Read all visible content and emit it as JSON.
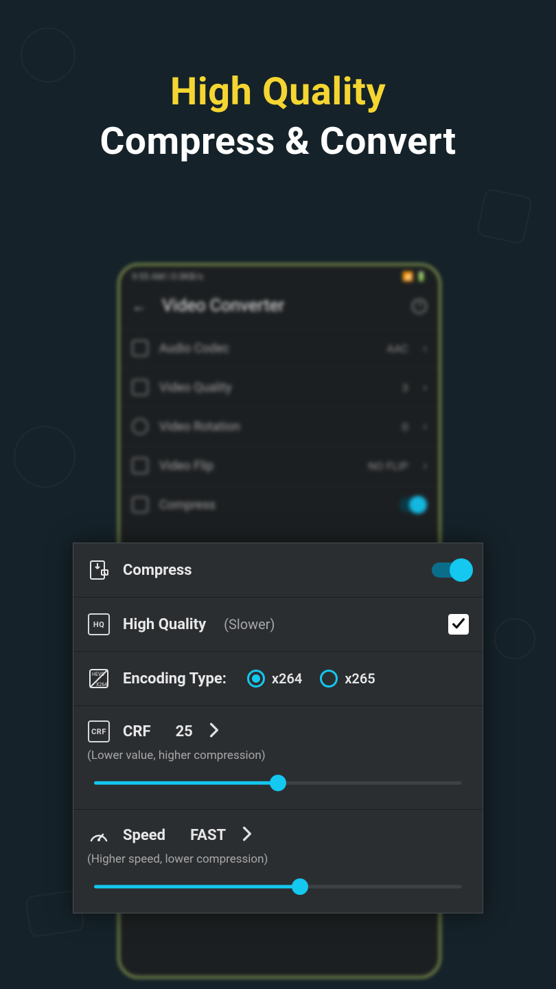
{
  "hero": {
    "line1": "High Quality",
    "line2": "Compress & Convert"
  },
  "phone": {
    "status_left": "9:55 AM | 0.0KB/s",
    "status_right": "📶 🔋",
    "title": "Video Converter",
    "rows": [
      {
        "label": "Audio Codec",
        "value": "AAC"
      },
      {
        "label": "Video Quality",
        "value": "3"
      },
      {
        "label": "Video Rotation",
        "value": "0"
      },
      {
        "label": "Video Flip",
        "value": "NO FLIP"
      }
    ],
    "compress_label": "Compress"
  },
  "card": {
    "compress": {
      "label": "Compress",
      "on": true
    },
    "high_quality": {
      "label": "High Quality",
      "hint": "(Slower)",
      "checked": true
    },
    "encoding": {
      "label": "Encoding Type:",
      "options": [
        {
          "label": "x264",
          "selected": true
        },
        {
          "label": "x265",
          "selected": false
        }
      ]
    },
    "crf": {
      "icon_text": "CRF",
      "label": "CRF",
      "value": "25",
      "hint": "(Lower value, higher compression)",
      "percent": 50
    },
    "speed": {
      "label": "Speed",
      "value": "FAST",
      "hint": "(Higher speed, lower compression)",
      "percent": 56
    }
  }
}
